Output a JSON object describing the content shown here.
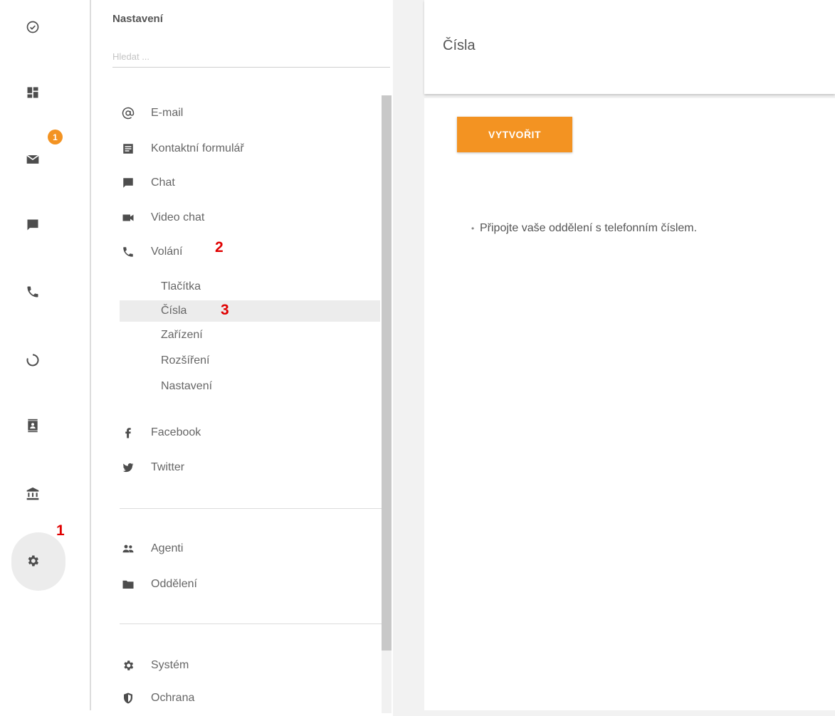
{
  "rail": {
    "badge_count": "1",
    "icons": [
      "check-circle-icon",
      "dashboard-icon",
      "mail-icon",
      "chat-icon",
      "phone-icon",
      "reports-icon",
      "contacts-icon",
      "knowledge-icon",
      "settings-icon"
    ]
  },
  "annotations": {
    "one": "1",
    "two": "2",
    "three": "3"
  },
  "settings": {
    "title": "Nastavení",
    "search_placeholder": "Hledat ..."
  },
  "nav": {
    "email": "E-mail",
    "contact_form": "Kontaktní formulář",
    "chat": "Chat",
    "video_chat": "Video chat",
    "calls": "Volání",
    "calls_sub": {
      "buttons": "Tlačítka",
      "numbers": "Čísla",
      "devices": "Zařízení",
      "extensions": "Rozšíření",
      "settings": "Nastavení"
    },
    "facebook": "Facebook",
    "twitter": "Twitter",
    "agents": "Agenti",
    "departments": "Oddělení",
    "system": "Systém",
    "protection": "Ochrana"
  },
  "content": {
    "title": "Čísla",
    "create_button": "VYTVOŘIT",
    "hints": [
      "Připojte vaše oddělení s telefonním číslem."
    ]
  },
  "colors": {
    "accent": "#f39322",
    "annotation": "#e00000",
    "active_bg": "#ececec"
  }
}
